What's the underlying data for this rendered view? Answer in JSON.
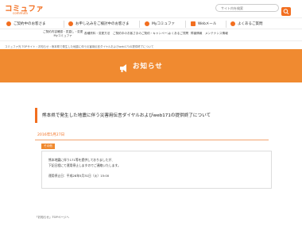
{
  "header": {
    "logo_text": "コミュファ",
    "logo_sub": "commufa",
    "search_placeholder": "サイト内を検索"
  },
  "nav": {
    "items": [
      {
        "label": "ご契約中のお客さま",
        "color": "#f26e1f"
      },
      {
        "label": "お申し込みをご検討中のお客さま",
        "color": "#f26e1f"
      },
      {
        "label": "Myコミュファ",
        "color": "#f26e1f"
      },
      {
        "label": "Webメール",
        "color": "#f26e1f"
      },
      {
        "label": "よくあるご質問",
        "color": "#f26e1f"
      }
    ]
  },
  "subnav": {
    "items": [
      {
        "line1": "ご契約内容確認・見直し・変更",
        "line2": "Myコミュファ"
      },
      {
        "line1": "各種資料・変更方法",
        "line2": ""
      },
      {
        "line1": "ご契約中のお客さまの",
        "line2": "ご契約・キャンペーン"
      },
      {
        "line1": "よくあるご質問",
        "line2": ""
      },
      {
        "line1": "障害情報",
        "line2": ""
      },
      {
        "line1": "メンテナンス情報",
        "line2": ""
      }
    ]
  },
  "breadcrumb": "コミュファ光 TOPサイト  ›  お知らせ  ›  熊本県で発生した地震に伴う災害用伝言ダイヤルおよびweb171の提供終了について",
  "banner": {
    "title": "お知らせ",
    "icon": "megaphone-icon"
  },
  "article": {
    "title": "熊本県で発生した地震に伴う災害用伝言ダイヤルおよびweb171の提供終了について",
    "date": "2016年5月27日",
    "badge": "その他",
    "lines": [
      "熊本地震に伴う171等を提供しておりましたが、",
      "下記日程にて運用停止しますのでご連絡いたします。",
      "運用停止日：平成28年5月31日（火）15:00"
    ]
  },
  "back_link": "「お知らせ」TOPページへ"
}
